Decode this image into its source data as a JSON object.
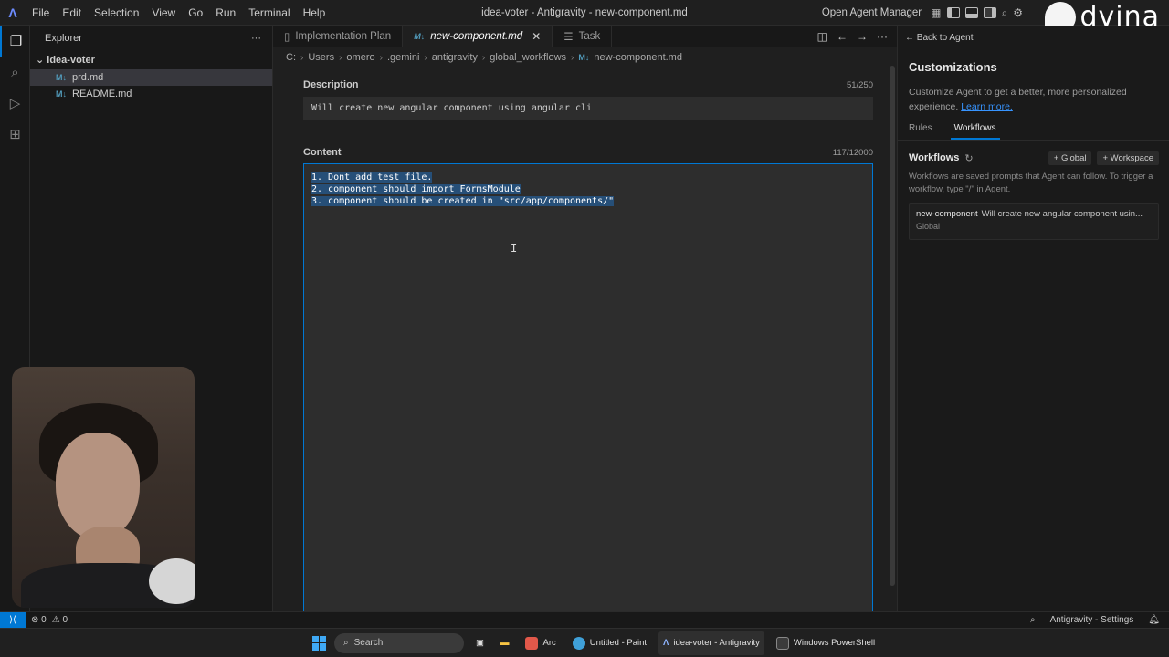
{
  "titlebar": {
    "menu": [
      "File",
      "Edit",
      "Selection",
      "View",
      "Go",
      "Run",
      "Terminal",
      "Help"
    ],
    "window_title": "idea-voter - Antigravity - new-component.md",
    "open_agent_manager": "Open Agent Manager",
    "brand": "dvina"
  },
  "sidebar": {
    "title": "Explorer",
    "folder": "idea-voter",
    "files": [
      {
        "name": "prd.md",
        "icon": "M↓"
      },
      {
        "name": "README.md",
        "icon": "M↓"
      }
    ]
  },
  "editor": {
    "tabs": [
      {
        "label": "Implementation Plan",
        "icon": "▯"
      },
      {
        "label": "new-component.md",
        "icon": "M↓",
        "close": "✕"
      },
      {
        "label": "Task",
        "icon": "☰"
      }
    ],
    "breadcrumb": [
      "C:",
      "Users",
      "omero",
      ".gemini",
      "antigravity",
      "global_workflows",
      "new-component.md"
    ],
    "description": {
      "label": "Description",
      "count": "51/250",
      "value": "Will create new angular component using angular cli"
    },
    "content": {
      "label": "Content",
      "count": "117/12000",
      "lines": [
        "1. Dont add test file.",
        "2. component should import FormsModule",
        "3. component should be created in \"src/app/components/\""
      ]
    }
  },
  "panel": {
    "back": "Back to Agent",
    "title": "Customizations",
    "desc": "Customize Agent to get a better, more personalized experience.",
    "learn_more": "Learn more.",
    "tabs": [
      "Rules",
      "Workflows"
    ],
    "workflows_title": "Workflows",
    "btn_global": "+ Global",
    "btn_workspace": "+ Workspace",
    "help": "Workflows are saved prompts that Agent can follow. To trigger a workflow, type \"/\" in Agent.",
    "card": {
      "name": "new-component",
      "desc": "Will create new angular component usin...",
      "scope": "Global"
    }
  },
  "statusbar": {
    "remote": "⟩⟨",
    "errors": "⊗ 0",
    "warnings": "⚠ 0",
    "settings": "Antigravity - Settings"
  },
  "taskbar": {
    "search": "Search",
    "apps": [
      {
        "label": "Arc",
        "color": "#e2584a"
      },
      {
        "label": "Untitled - Paint",
        "color": "#3fa0d8"
      },
      {
        "label": "idea-voter - Antigravity",
        "color": "#2b2b2b"
      },
      {
        "label": "Windows PowerShell",
        "color": "#3b3b3b"
      }
    ]
  }
}
